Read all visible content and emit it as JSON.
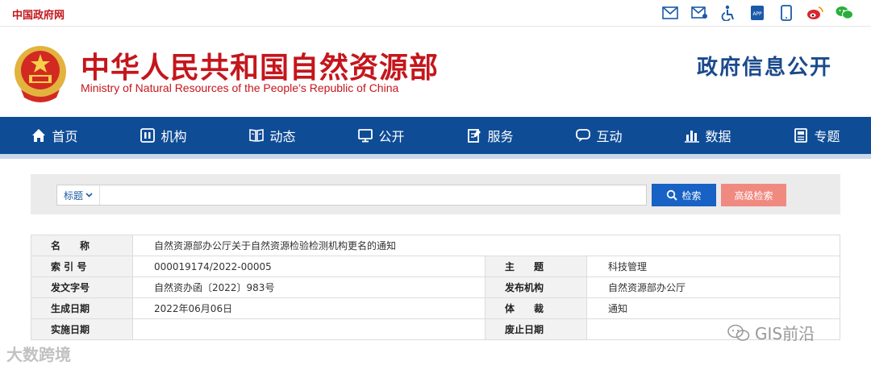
{
  "topbar": {
    "portal_link": "中国政府网"
  },
  "topicons": [
    "mail-icon",
    "email-icon",
    "accessibility-icon",
    "app-icon",
    "mobile-icon",
    "weibo-icon",
    "wechat-icon"
  ],
  "topicon_labels": {
    "app": "APP"
  },
  "header": {
    "title_cn": "中华人民共和国自然资源部",
    "title_en": "Ministry of Natural Resources of the People’s Republic of China",
    "portal_title": "政府信息公开"
  },
  "nav": [
    {
      "label": "首页",
      "icon": "home-icon"
    },
    {
      "label": "机构",
      "icon": "org-icon"
    },
    {
      "label": "动态",
      "icon": "book-icon"
    },
    {
      "label": "公开",
      "icon": "monitor-icon"
    },
    {
      "label": "服务",
      "icon": "edit-icon"
    },
    {
      "label": "互动",
      "icon": "chat-icon"
    },
    {
      "label": "数据",
      "icon": "chart-icon"
    },
    {
      "label": "专题",
      "icon": "topic-icon"
    }
  ],
  "search": {
    "select_value": "标题",
    "input_value": "",
    "search_label": "检索",
    "advanced_label": "高级检索"
  },
  "meta": {
    "name_label": "名　　称",
    "name_value": "自然资源部办公厅关于自然资源检验检测机构更名的通知",
    "index_label": "索 引 号",
    "index_value": "000019174/2022-00005",
    "topic_label": "主　　题",
    "topic_value": "科技管理",
    "docno_label": "发文字号",
    "docno_value": "自然资办函〔2022〕983号",
    "org_label": "发布机构",
    "org_value": "自然资源部办公厅",
    "date_label": "生成日期",
    "date_value": "2022年06月06日",
    "genre_label": "体　　裁",
    "genre_value": "通知",
    "impl_label": "实施日期",
    "impl_value": "",
    "expire_label": "废止日期",
    "expire_value": ""
  },
  "watermarks": {
    "left": "大数跨境",
    "right": "GIS前沿"
  },
  "colors": {
    "brand_red": "#c4161c",
    "nav_blue": "#0f4c96",
    "search_blue": "#1762c4",
    "adv_pink": "#f08a80"
  }
}
